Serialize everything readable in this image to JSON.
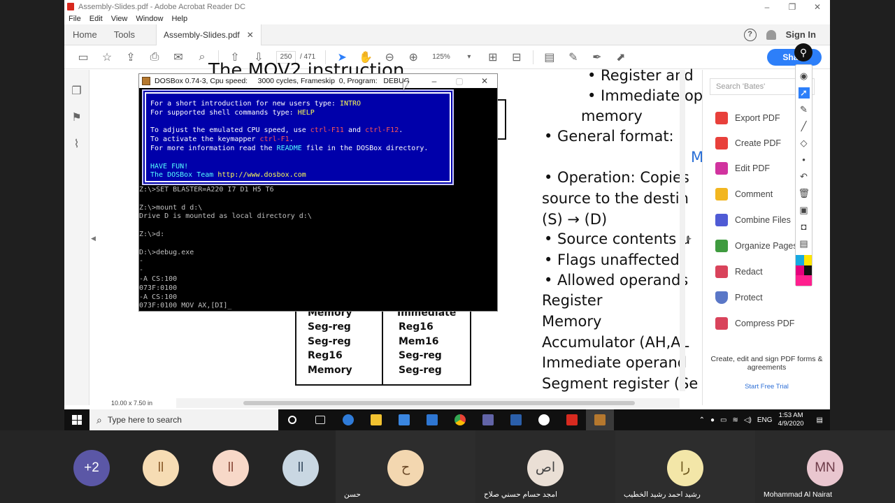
{
  "acrobat": {
    "window_title": "Assembly-Slides.pdf - Adobe Acrobat Reader DC",
    "menu": [
      "File",
      "Edit",
      "View",
      "Window",
      "Help"
    ],
    "nav_tabs": [
      "Home",
      "Tools"
    ],
    "doc_tab": "Assembly-Slides.pdf",
    "sign_in": "Sign In",
    "page_current": "250",
    "page_total": "/ 471",
    "zoom": "125%",
    "share": "Share",
    "page_size": "10.00 x 7.50 in",
    "search_placeholder": "Search 'Bates'",
    "tools": [
      {
        "label": "Export PDF",
        "color": "#e8403b"
      },
      {
        "label": "Create PDF",
        "color": "#e8403b"
      },
      {
        "label": "Edit PDF",
        "color": "#d1339f"
      },
      {
        "label": "Comment",
        "color": "#f2b620"
      },
      {
        "label": "Combine Files",
        "color": "#4f5bd5"
      },
      {
        "label": "Organize Pages",
        "color": "#3f9b3f"
      },
      {
        "label": "Redact",
        "color": "#d9435b"
      },
      {
        "label": "Protect",
        "color": "#5a77c7"
      },
      {
        "label": "Compress PDF",
        "color": "#d9435b"
      }
    ],
    "promo_text": "Create, edit and sign PDF forms & agreements",
    "promo_link": "Start Free Trial"
  },
  "slide": {
    "title": "The MOV2 instruction",
    "lines": [
      "• Register and",
      "• Immediate op",
      "memory",
      "• General format:",
      "M",
      "• Operation: Copies",
      "source to the destin",
      "(S) → (D)",
      "• Source contents u",
      "• Flags unaffected",
      "• Allowed operands",
      "Register",
      "Memory",
      "Accumulator (AH,AL",
      "Immediate operand",
      "Segment register (Se"
    ],
    "table_left": [
      "Memory",
      "Seg-reg",
      "Seg-reg",
      "Reg16",
      "Memory"
    ],
    "table_right": [
      "Immediate",
      "Reg16",
      "Mem16",
      "Seg-reg",
      "Seg-reg"
    ]
  },
  "dosbox": {
    "title": "DOSBox 0.74-3, Cpu speed:     3000 cycles, Frameskip  0, Program:   DEBUG",
    "banner": {
      "l1a": "For a short introduction for new users type: ",
      "l1b": "INTRO",
      "l2a": "For supported shell commands type: ",
      "l2b": "HELP",
      "l3a": "To adjust the emulated CPU speed, use ",
      "l3b": "ctrl-F11",
      "l3c": " and ",
      "l3d": "ctrl-F12",
      "l3e": ".",
      "l4a": "To activate the keymapper ",
      "l4b": "ctrl-F1",
      "l4c": ".",
      "l5a": "For more information read the ",
      "l5b": "README",
      "l5c": " file in the DOSBox directory.",
      "l6": "HAVE FUN!",
      "l7a": "The DOSBox Team ",
      "l7b": "http://www.dosbox.com"
    },
    "console": [
      "Z:\\>SET BLASTER=A220 I7 D1 H5 T6",
      "",
      "Z:\\>mount d d:\\",
      "Drive D is mounted as local directory d:\\",
      "",
      "Z:\\>d:",
      "",
      "D:\\>debug.exe",
      "-",
      "-",
      "-A CS:100",
      "073F:0100",
      "-A CS:100",
      "073F:0100 MOV AX,[DI]_"
    ]
  },
  "taskbar": {
    "search": "Type here to search",
    "lang": "ENG",
    "time": "1:53 AM",
    "date": "4/9/2020",
    "apps": [
      {
        "name": "cortana",
        "color": "#ffffff"
      },
      {
        "name": "task-view",
        "color": "#dddddd"
      },
      {
        "name": "edge",
        "color": "#2f7bd8"
      },
      {
        "name": "file-explorer",
        "color": "#f2c230"
      },
      {
        "name": "store",
        "color": "#3a86e0"
      },
      {
        "name": "mail",
        "color": "#2e76d2"
      },
      {
        "name": "chrome",
        "color": "#e94235"
      },
      {
        "name": "teams",
        "color": "#6264a7"
      },
      {
        "name": "word",
        "color": "#2b5faa"
      },
      {
        "name": "maps",
        "color": "#111111"
      },
      {
        "name": "acrobat",
        "color": "#d72a1f"
      },
      {
        "name": "dosbox",
        "color": "#b5782e"
      }
    ]
  },
  "meeting": {
    "participants": [
      {
        "initials": "+2",
        "bg": "#5b57a6",
        "fg": "#ffffff",
        "name": ""
      },
      {
        "initials": "ll",
        "bg": "#f6dcb4",
        "fg": "#8a5a2a",
        "name": ""
      },
      {
        "initials": "ll",
        "bg": "#f7d8c8",
        "fg": "#8a4a3a",
        "name": ""
      },
      {
        "initials": "ll",
        "bg": "#c9d7e2",
        "fg": "#3a4f63",
        "name": ""
      },
      {
        "initials": "ح",
        "bg": "#f3d7b0",
        "fg": "#6d4b2a",
        "name": "حسن"
      },
      {
        "initials": "اص",
        "bg": "#eadfd5",
        "fg": "#444444",
        "name": "امجد حسام حسني صلاح"
      },
      {
        "initials": "را",
        "bg": "#f3e6a8",
        "fg": "#6f5a1f",
        "name": "رشيد احمد رشيد الخطيب"
      },
      {
        "initials": "MN",
        "bg": "#e9c6cf",
        "fg": "#6c3a47",
        "name": "Mohammad Al Nairat"
      }
    ]
  }
}
